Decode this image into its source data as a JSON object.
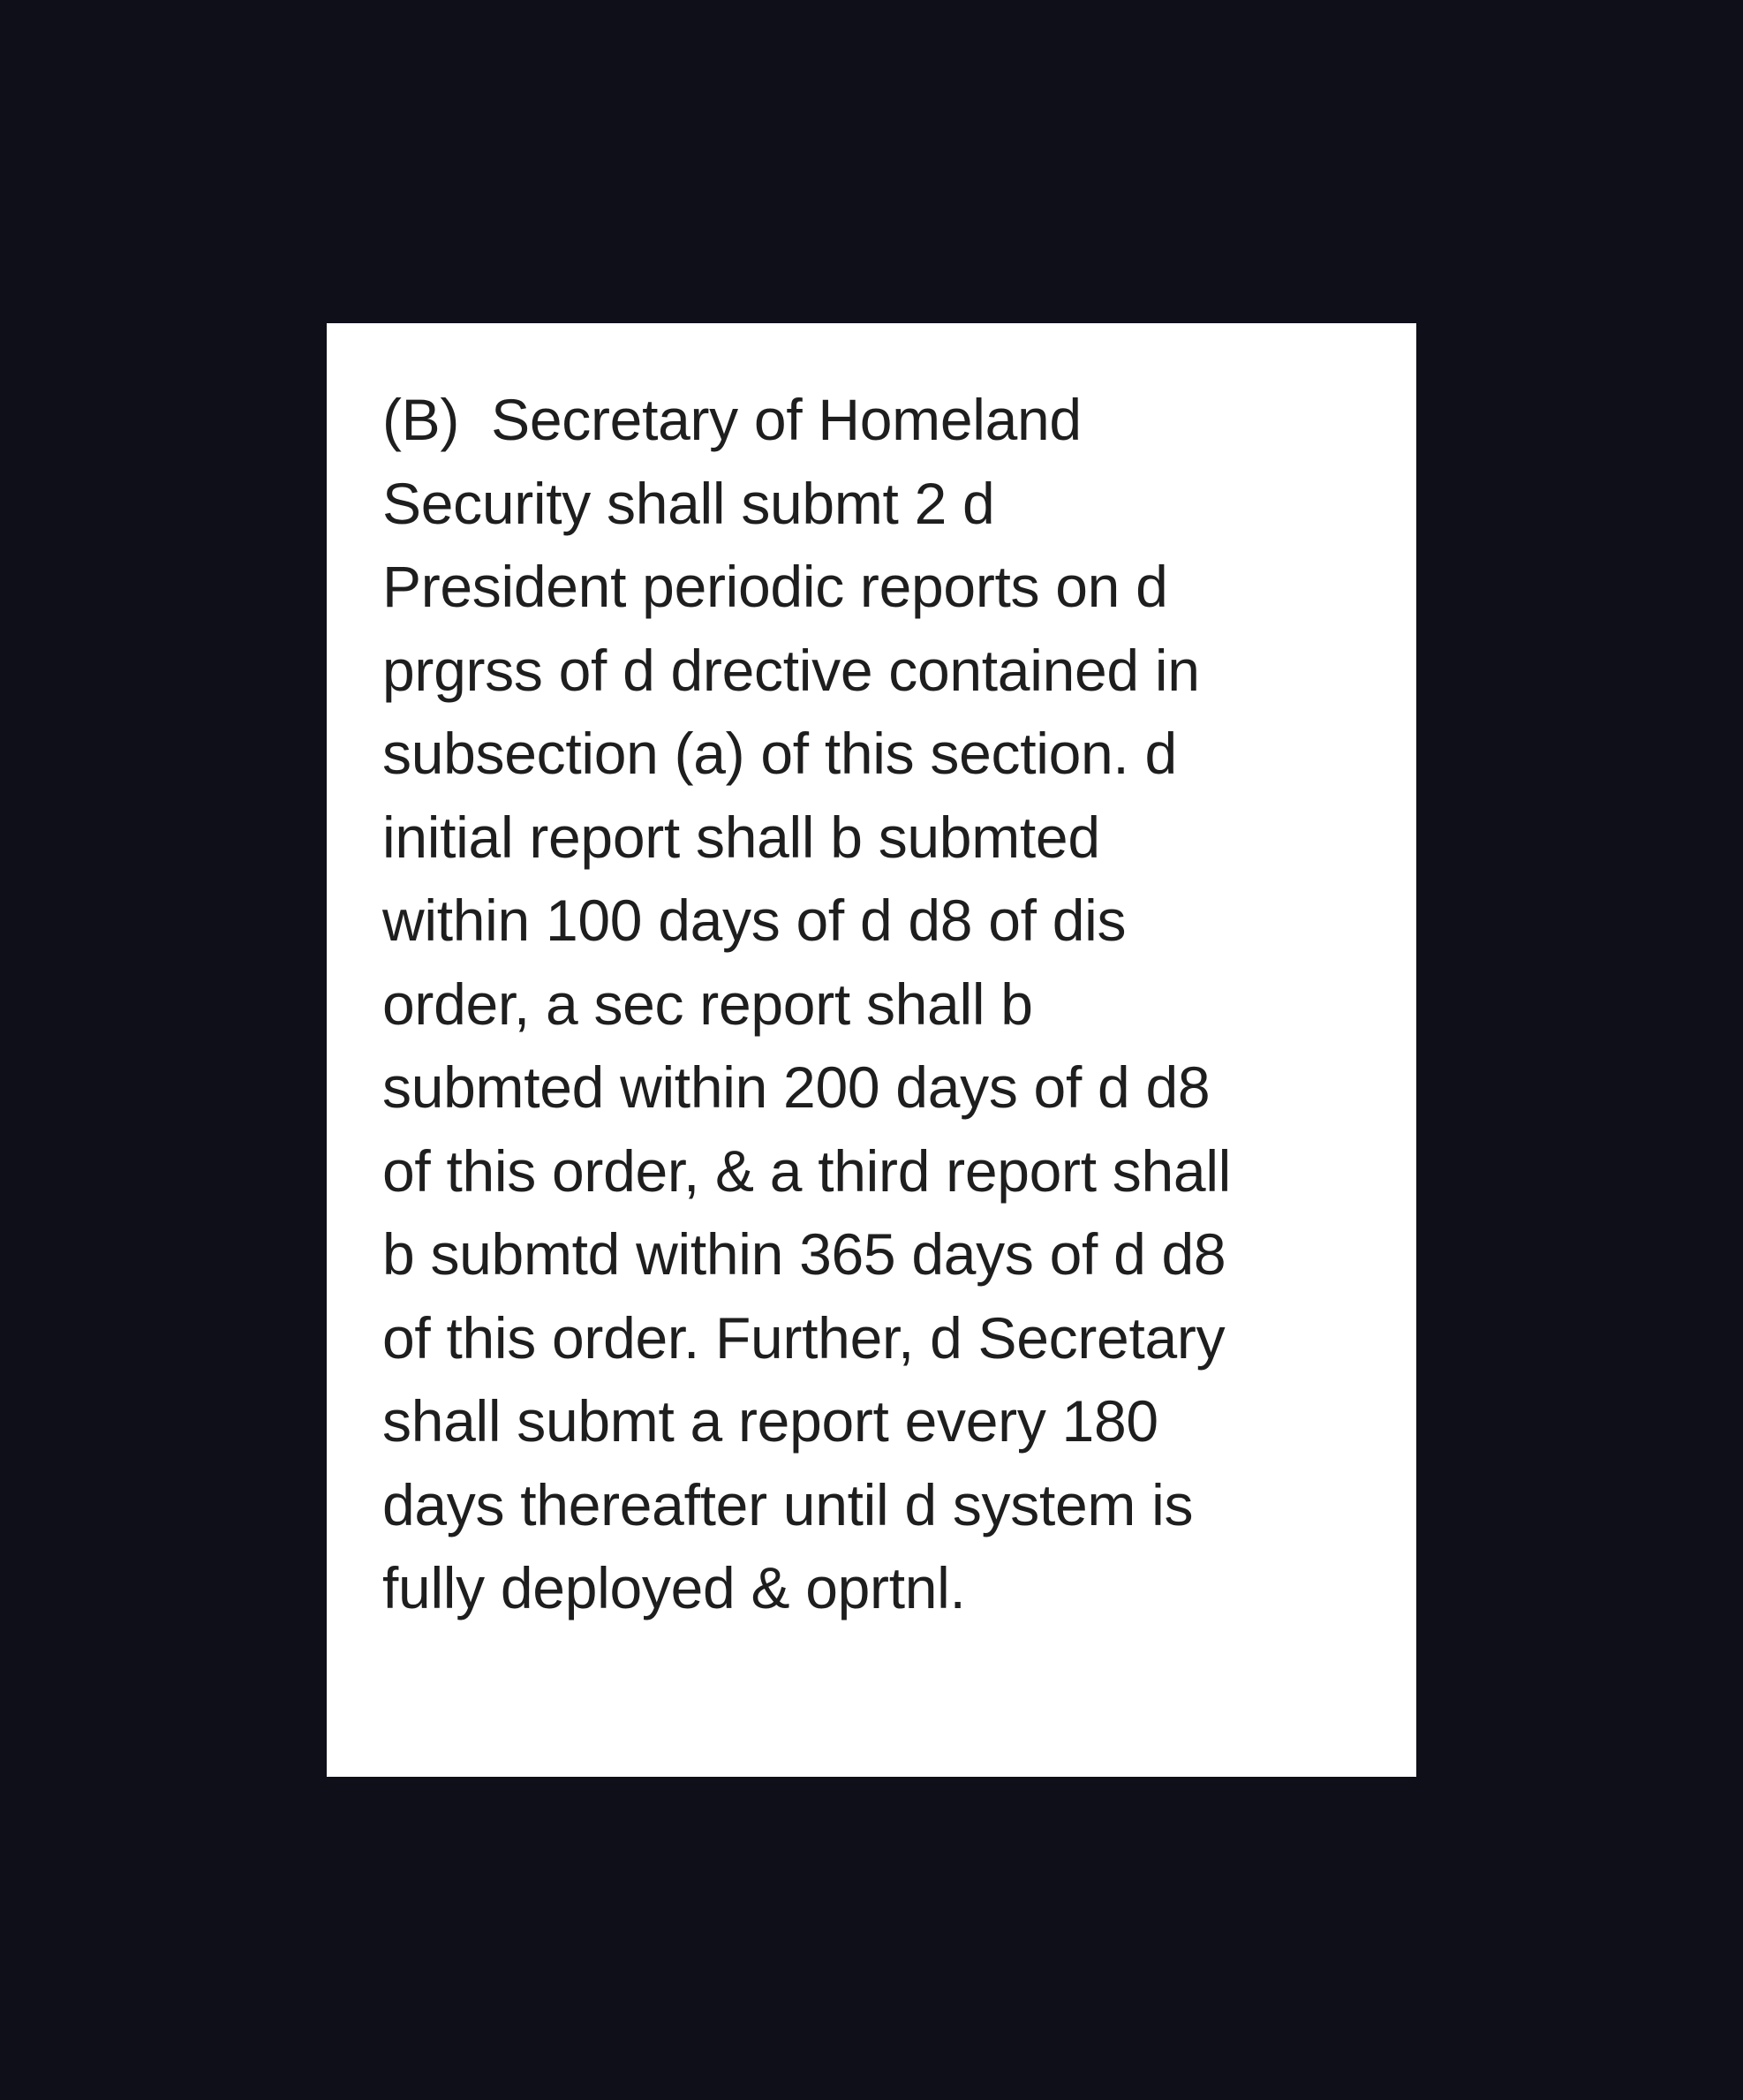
{
  "document": {
    "lines": [
      "(B)  Secretary of Homeland",
      "Security shall submt 2 d",
      "President periodic reports on d",
      "prgrss of d drective contained in",
      "subsection (a) of this section. d",
      "initial report shall b submted",
      "within 100 days of d d8 of dis",
      "order, a sec report shall b",
      "submted within 200 days of d d8",
      "of this order, & a third report shall",
      "b submtd within 365 days of d d8",
      "of this order. Further, d Secretary",
      "shall submt a report every 180",
      "days thereafter until d system is",
      "fully deployed & oprtnl."
    ]
  }
}
